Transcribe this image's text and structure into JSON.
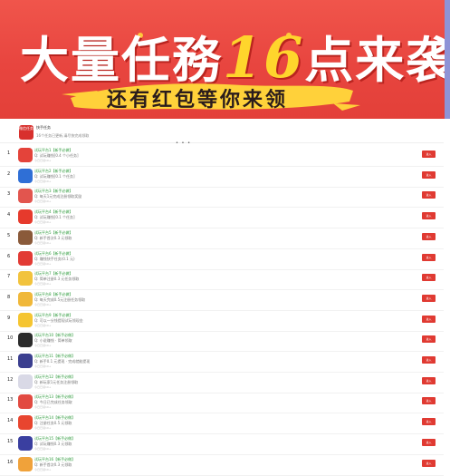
{
  "banner": {
    "title_a": "大量任務",
    "title_num": "16",
    "title_b": "点来袭",
    "subtitle": "还有红包等你来领"
  },
  "app": {
    "logo_text": "微信任务",
    "name": "快手任务",
    "desc": "16个任务已更新,请尽快完成领取",
    "pager": "• • •"
  },
  "go_label": "进入",
  "rows": [
    {
      "rank": "1",
      "t1": "试玩平台1【新手必做】",
      "t2": "Q: 试玩赚钱[0.4 个小任务]",
      "t3": "今日已领10+",
      "color": "#e4433a"
    },
    {
      "rank": "2",
      "t1": "试玩平台2【新手必做】",
      "t2": "Q: 试玩赚钱[0.1 个任务]",
      "t3": "今日已领10+",
      "color": "#2f6fd6"
    },
    {
      "rank": "3",
      "t1": "试玩平台3【新手必做】",
      "t2": "Q: 每天1元完成注册领取奖励",
      "t3": "今日已领10+",
      "color": "#e2554e"
    },
    {
      "rank": "4",
      "t1": "试玩平台4【新手必做】",
      "t2": "Q: 试玩赚钱[0.1 个任务]",
      "t3": "今日已领10+",
      "color": "#e63a2c"
    },
    {
      "rank": "5",
      "t1": "试玩平台5【新手必做】",
      "t2": "Q: 新手首次0.3 元领取",
      "t3": "今日已领10+",
      "color": "#8a5a3a"
    },
    {
      "rank": "6",
      "t1": "试玩平台6【新手必做】",
      "t2": "Q: 赚钱快手任务(0.1 元)",
      "t3": "今日已领10+",
      "color": "#e23b34"
    },
    {
      "rank": "7",
      "t1": "试玩平台7【新手必做】",
      "t2": "Q: 简单注册0.3 元任务领取",
      "t3": "今日已领10+",
      "color": "#f2c33d"
    },
    {
      "rank": "8",
      "t1": "试玩平台8【新手必做】",
      "t2": "Q: 每天完成0.5元注册任务领取",
      "t3": "今日已领10+",
      "color": "#f0b83a"
    },
    {
      "rank": "9",
      "t1": "试玩平台9【新手必做】",
      "t2": "Q: 可以一分钱提现试玩领现金",
      "t3": "今日已领10+",
      "color": "#f5c531"
    },
    {
      "rank": "10",
      "t1": "试玩平台10【新手必做】",
      "t2": "Q: 小说赚钱 · 简单领取",
      "t3": "今日已领10+",
      "color": "#2b2b2b"
    },
    {
      "rank": "11",
      "t1": "试玩平台11【新手必做】",
      "t2": "Q: 新手0.1 元提现 · 完成就能提现",
      "t3": "今日已领10+",
      "color": "#3b3f8f"
    },
    {
      "rank": "12",
      "t1": "试玩平台12【新手必做】",
      "t2": "Q: 新玩家1元任务注册领取",
      "t3": "今日已领10+",
      "color": "#d9d9e6"
    },
    {
      "rank": "13",
      "t1": "试玩平台13【新手必做】",
      "t2": "Q: 今日已完成任务领取",
      "t3": "今日已领10+",
      "color": "#e24a41"
    },
    {
      "rank": "14",
      "t1": "试玩平台14【新手必做】",
      "t2": "Q: 注册任务0.5 元领取",
      "t3": "今日已领10+",
      "color": "#e8452f"
    },
    {
      "rank": "15",
      "t1": "试玩平台15【新手必做】",
      "t2": "Q: 试玩赚钱0.3 元领取",
      "t3": "今日已领10+",
      "color": "#3a3fa0"
    },
    {
      "rank": "16",
      "t1": "试玩平台16【新手必做】",
      "t2": "Q: 新手首次0.3 元领取",
      "t3": "今日已领10+",
      "color": "#f0a23a"
    }
  ]
}
